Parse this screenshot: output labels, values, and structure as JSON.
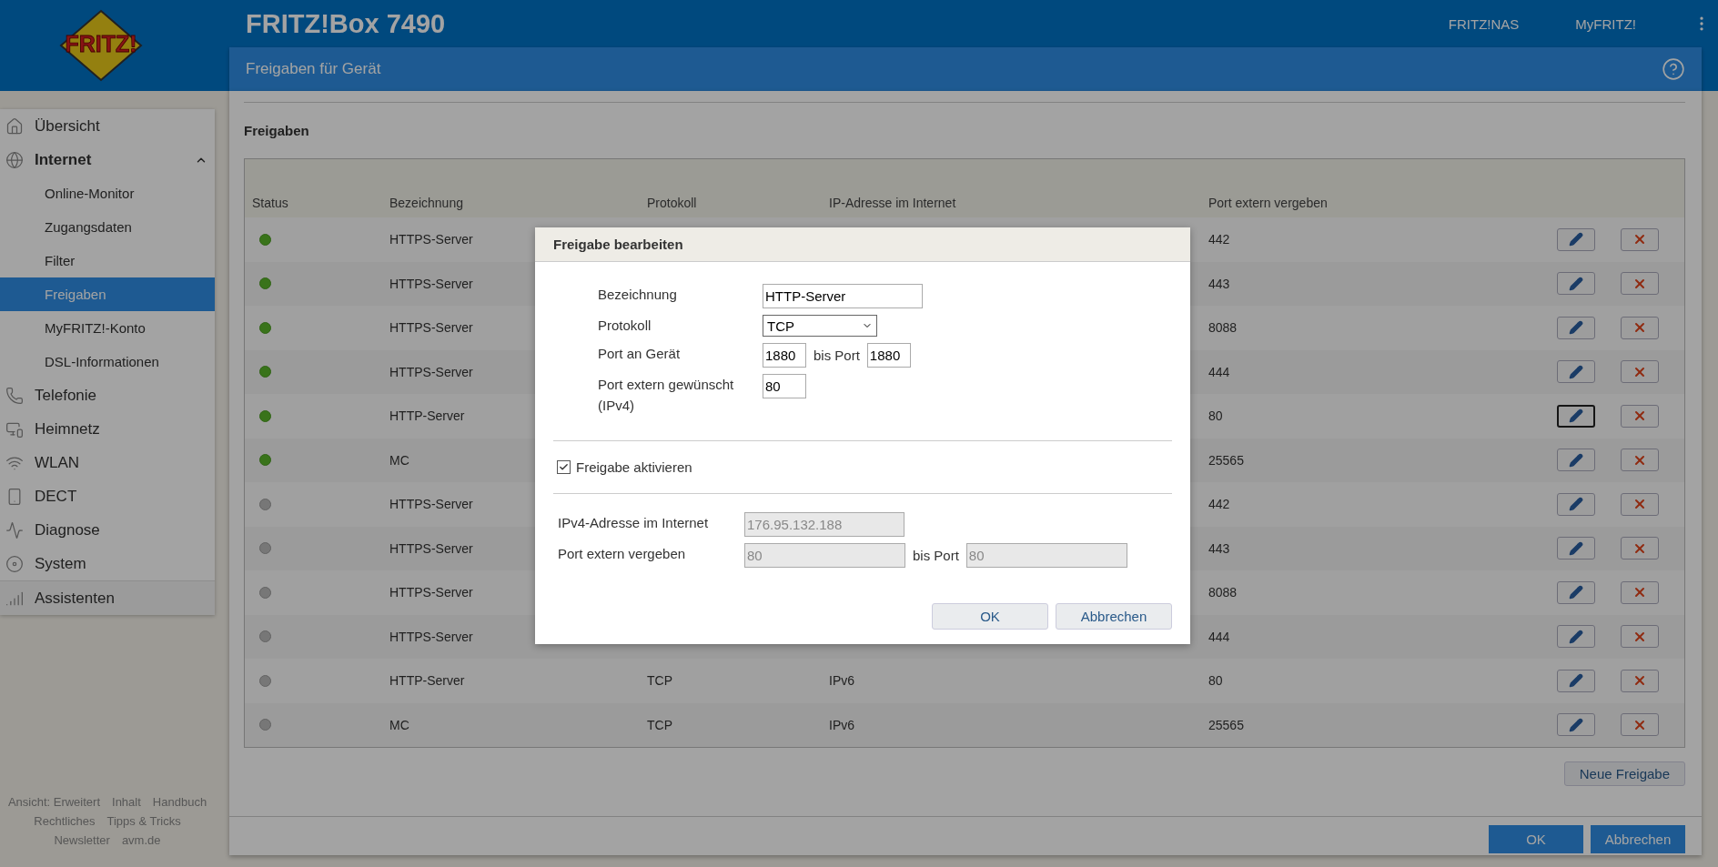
{
  "header": {
    "logo": "FRITZ!",
    "title": "FRITZ!Box 7490",
    "links": [
      "FRITZ!NAS",
      "MyFRITZ!"
    ]
  },
  "page": {
    "title": "Freigaben für Gerät"
  },
  "sidebar": {
    "items": [
      {
        "kind": "home",
        "label": "Übersicht"
      },
      {
        "kind": "globe",
        "label": "Internet",
        "expanded": true,
        "children": [
          {
            "label": "Online-Monitor",
            "selected": false
          },
          {
            "label": "Zugangsdaten",
            "selected": false
          },
          {
            "label": "Filter",
            "selected": false
          },
          {
            "label": "Freigaben",
            "selected": true
          },
          {
            "label": "MyFRITZ!-Konto",
            "selected": false
          },
          {
            "label": "DSL-Informationen",
            "selected": false
          }
        ]
      },
      {
        "kind": "phone",
        "label": "Telefonie"
      },
      {
        "kind": "network",
        "label": "Heimnetz"
      },
      {
        "kind": "wifi",
        "label": "WLAN"
      },
      {
        "kind": "handset",
        "label": "DECT"
      },
      {
        "kind": "diagnose",
        "label": "Diagnose"
      },
      {
        "kind": "system",
        "label": "System"
      }
    ],
    "extra_items": [
      {
        "kind": "wizard",
        "label": "Assistenten"
      }
    ],
    "footer_links": [
      [
        "Ansicht: Erweitert",
        "Inhalt",
        "Handbuch"
      ],
      [
        "Rechtliches",
        "Tipps & Tricks"
      ],
      [
        "Newsletter",
        "avm.de"
      ]
    ]
  },
  "section": {
    "title": "Freigaben"
  },
  "table": {
    "columns": [
      "Status",
      "Bezeichnung",
      "Protokoll",
      "IP-Adresse im Internet",
      "Port extern vergeben"
    ],
    "rows": [
      {
        "active": true,
        "name": "HTTPS-Server",
        "port": "442",
        "focused": false
      },
      {
        "active": true,
        "name": "HTTPS-Server",
        "port": "443",
        "focused": false
      },
      {
        "active": true,
        "name": "HTTPS-Server",
        "port": "8088",
        "focused": false
      },
      {
        "active": true,
        "name": "HTTPS-Server",
        "port": "444",
        "focused": false
      },
      {
        "active": true,
        "name": "HTTP-Server",
        "port": "80",
        "focused": true
      },
      {
        "active": true,
        "name": "MC",
        "port": "25565",
        "focused": false
      },
      {
        "active": false,
        "name": "HTTPS-Server",
        "port": "442",
        "focused": false
      },
      {
        "active": false,
        "name": "HTTPS-Server",
        "port": "443",
        "focused": false
      },
      {
        "active": false,
        "name": "HTTPS-Server",
        "port": "8088",
        "focused": false
      },
      {
        "active": false,
        "name": "HTTPS-Server",
        "port": "444",
        "focused": false
      },
      {
        "active": false,
        "name": "HTTP-Server",
        "protocol": "TCP",
        "ip": "IPv6",
        "port": "80",
        "focused": false
      },
      {
        "active": false,
        "name": "MC",
        "protocol": "TCP",
        "ip": "IPv6",
        "port": "25565",
        "focused": false
      }
    ]
  },
  "new_button": "Neue Freigabe",
  "footer_buttons": [
    "OK",
    "Abbrechen"
  ],
  "dialog": {
    "title": "Freigabe bearbeiten",
    "fields": [
      {
        "kind": "text",
        "label": "Bezeichnung",
        "value": "HTTP-Server"
      },
      {
        "kind": "select",
        "label": "Protokoll",
        "value": "TCP"
      },
      {
        "kind": "range",
        "label": "Port an Gerät",
        "value": "1880",
        "to_label": "bis Port",
        "to_value": "1880"
      },
      {
        "kind": "short",
        "label": "Port extern gewünscht (IPv4)",
        "value": "80"
      }
    ],
    "checkbox": {
      "label": "Freigabe aktivieren",
      "checked": true
    },
    "info_fields": [
      {
        "kind": "text",
        "label": "IPv4-Adresse im Internet",
        "value": "176.95.132.188",
        "disabled": true
      },
      {
        "kind": "range",
        "label": "Port extern vergeben",
        "value": "80",
        "to_label": "bis Port",
        "to_value": "80",
        "disabled": true
      }
    ],
    "buttons": [
      "OK",
      "Abbrechen"
    ]
  }
}
